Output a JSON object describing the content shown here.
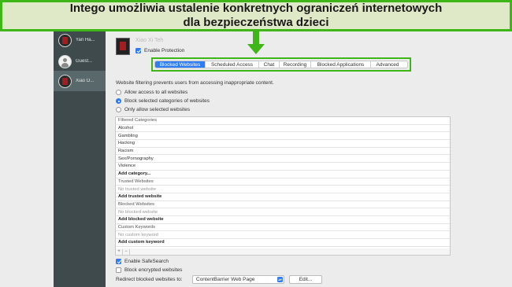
{
  "banner": {
    "line1": "Intego umożliwia ustalenie konkretnych ograniczeń internetowych",
    "line2": "dla bezpieczeństwa dzieci",
    "color": "#3fb618"
  },
  "sidebar": {
    "users": [
      {
        "name": "Yan Ha...",
        "icon": "user-avatar-icon",
        "selected": false
      },
      {
        "name": "Guest...",
        "icon": "guest-avatar-icon",
        "selected": false
      },
      {
        "name": "Xiao O...",
        "icon": "user-avatar-icon",
        "selected": true
      }
    ]
  },
  "profile": {
    "name": "Xiao Xi Teh",
    "enable_protection": "Enable Protection"
  },
  "tabs": [
    {
      "label": "Blocked Websites",
      "active": true
    },
    {
      "label": "Scheduled Access",
      "active": false
    },
    {
      "label": "Chat",
      "active": false
    },
    {
      "label": "Recording",
      "active": false
    },
    {
      "label": "Blocked Applications",
      "active": false
    },
    {
      "label": "Advanced",
      "active": false
    }
  ],
  "content": {
    "description": "Website filtering prevents users from accessing inappropriate content.",
    "options": [
      "Allow access to all websites",
      "Block selected categories of websites",
      "Only allow selected websites"
    ],
    "selected_option": "Block selected categories of websites",
    "list": [
      {
        "text": "Filtered Categories",
        "style": "hdr"
      },
      {
        "text": "Alcohol",
        "style": ""
      },
      {
        "text": "Gambling",
        "style": ""
      },
      {
        "text": "Hacking",
        "style": ""
      },
      {
        "text": "Racism",
        "style": ""
      },
      {
        "text": "Sex/Pornography",
        "style": ""
      },
      {
        "text": "Violence",
        "style": ""
      },
      {
        "text": "Add category...",
        "style": "bold"
      },
      {
        "text": "Trusted Websites",
        "style": "hdr"
      },
      {
        "text": "No trusted website",
        "style": "ph"
      },
      {
        "text": "Add trusted website",
        "style": "bold"
      },
      {
        "text": "Blocked Websites",
        "style": "hdr"
      },
      {
        "text": "No blocked website",
        "style": "ph"
      },
      {
        "text": "Add blocked website",
        "style": "bold"
      },
      {
        "text": "Custom Keywords",
        "style": "hdr"
      },
      {
        "text": "No custom keyword",
        "style": "ph"
      },
      {
        "text": "Add custom keyword",
        "style": "bold"
      }
    ],
    "list_controls": {
      "add": "+",
      "remove": "−"
    },
    "safesearch": "Enable SafeSearch",
    "block_encrypted": "Block encrypted websites",
    "redirect_label": "Redirect blocked websites to:",
    "redirect_value": "ContentBarrier Web Page",
    "edit_button": "Edit..."
  },
  "accent_color": "#2e7cf6"
}
